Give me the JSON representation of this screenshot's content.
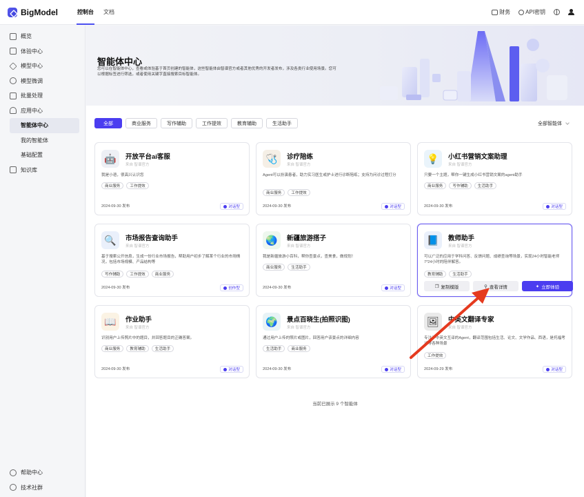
{
  "header": {
    "logo": "BigModel",
    "nav": [
      "控制台",
      "文档"
    ],
    "right": {
      "finance": "财务",
      "api_key": "API密钥"
    }
  },
  "sidebar": {
    "items": [
      {
        "label": "概览"
      },
      {
        "label": "体验中心"
      },
      {
        "label": "模型中心"
      },
      {
        "label": "模型微调"
      },
      {
        "label": "批量处理"
      },
      {
        "label": "应用中心"
      }
    ],
    "sub_items": [
      "智能体中心",
      "我的智能体",
      "基础配置"
    ],
    "knowledge": "知识库",
    "bottom": [
      "帮助中心",
      "技术社群"
    ]
  },
  "hero": {
    "title": "智能体中心",
    "desc": "您可以在智能体中心，查看或体验基于首页创建的智能体，这些智能体由智谱官方或者其他优秀的开发者发布，涉及各类行业使用场景。您可以根据标签进行筛选，或者使用关键字直接搜索目标智能体。"
  },
  "filters": [
    "全部",
    "商业服务",
    "写作辅助",
    "工作提效",
    "教育辅助",
    "生活助手"
  ],
  "all_select": "全部智能体",
  "cards": [
    {
      "title": "开放平台ai客服",
      "sub": "来自 智谱官方",
      "desc": "我是小语，很高兴认识您",
      "tags": [
        "商业服务",
        "工作提效"
      ],
      "date": "2024-09-30 发布",
      "type": "对话型",
      "icon": "robot-icon"
    },
    {
      "title": "诊疗陪练",
      "sub": "来自 智谱官方",
      "desc": "Agent可以扮演患者，助力实习医生或护士进行诊断陪练；支持为问诊过程打分",
      "tags": [
        "商业服务",
        "工作提效"
      ],
      "date": "2024-09-30 发布",
      "type": "对话型",
      "icon": "stethoscope-icon"
    },
    {
      "title": "小红书营销文案助理",
      "sub": "来自 智谱官方",
      "desc": "只要一个主题，帮你一键生成小红书营销文案的agent助手",
      "tags": [
        "商业服务",
        "写作辅助",
        "生活助手"
      ],
      "date": "2024-09-30 发布",
      "type": "对话型",
      "icon": "lightbulb-icon"
    },
    {
      "title": "市场报告查询助手",
      "sub": "来自 智谱官方",
      "desc": "基于搜索公开信息，生成一份行业市场报告，帮助用户初步了解某个行业的市场情况，包括市场规模、产品结构等",
      "tags": [
        "写作辅助",
        "工作提效",
        "商业服务"
      ],
      "date": "2024-09-30 发布",
      "type": "创作型",
      "icon": "magnifier-icon"
    },
    {
      "title": "新疆旅游搭子",
      "sub": "来自 智谱官方",
      "desc": "我是新疆旅游小百科，帮你查景点，查美食，做规划！",
      "tags": [
        "商业服务",
        "生活助手"
      ],
      "date": "2024-09-30 发布",
      "type": "对话型",
      "icon": "globe-icon"
    },
    {
      "title": "教师助手",
      "sub": "来自 智谱官方",
      "desc": "可以广泛的应用于学科问答、反馈问题、成绩查询等场景，实现24小时智能老师 7*24小时的陪伴解答。",
      "tags": [
        "教育辅助",
        "生活助手"
      ],
      "date": "",
      "type": "",
      "icon": "book-icon",
      "actions": [
        "复制模版",
        "查看详情",
        "立即体验"
      ]
    },
    {
      "title": "作业助手",
      "sub": "来自 智谱官方",
      "desc": "识别用户上传照片中的题目，并回答题目的正确答案。",
      "tags": [
        "商业服务",
        "教育辅助",
        "生活助手"
      ],
      "date": "2024-09-30 发布",
      "type": "对话型",
      "icon": "open-book-icon"
    },
    {
      "title": "景点百晓生(拍照识图)",
      "sub": "来自 智谱官方",
      "desc": "通过用户上传的照片或图片，回答用户该景点的详细内容",
      "tags": [
        "生活助手",
        "商业服务"
      ],
      "date": "2024-09-30 发布",
      "type": "对话型",
      "icon": "earth-icon"
    },
    {
      "title": "中英文翻译专家",
      "sub": "来自 智谱官方",
      "desc": "专注于中英文互译的Agent，翻译范围包括生活、论文、文学作品、西语，是托福考试等各种场景",
      "tags": [
        "工作提效"
      ],
      "date": "2024-09-29 发布",
      "type": "对话型",
      "icon": "translate-icon"
    }
  ],
  "footer": "当前已展示 9 个智能体",
  "colors": {
    "accent": "#4b3df0",
    "arrow": "#e53a1f"
  }
}
